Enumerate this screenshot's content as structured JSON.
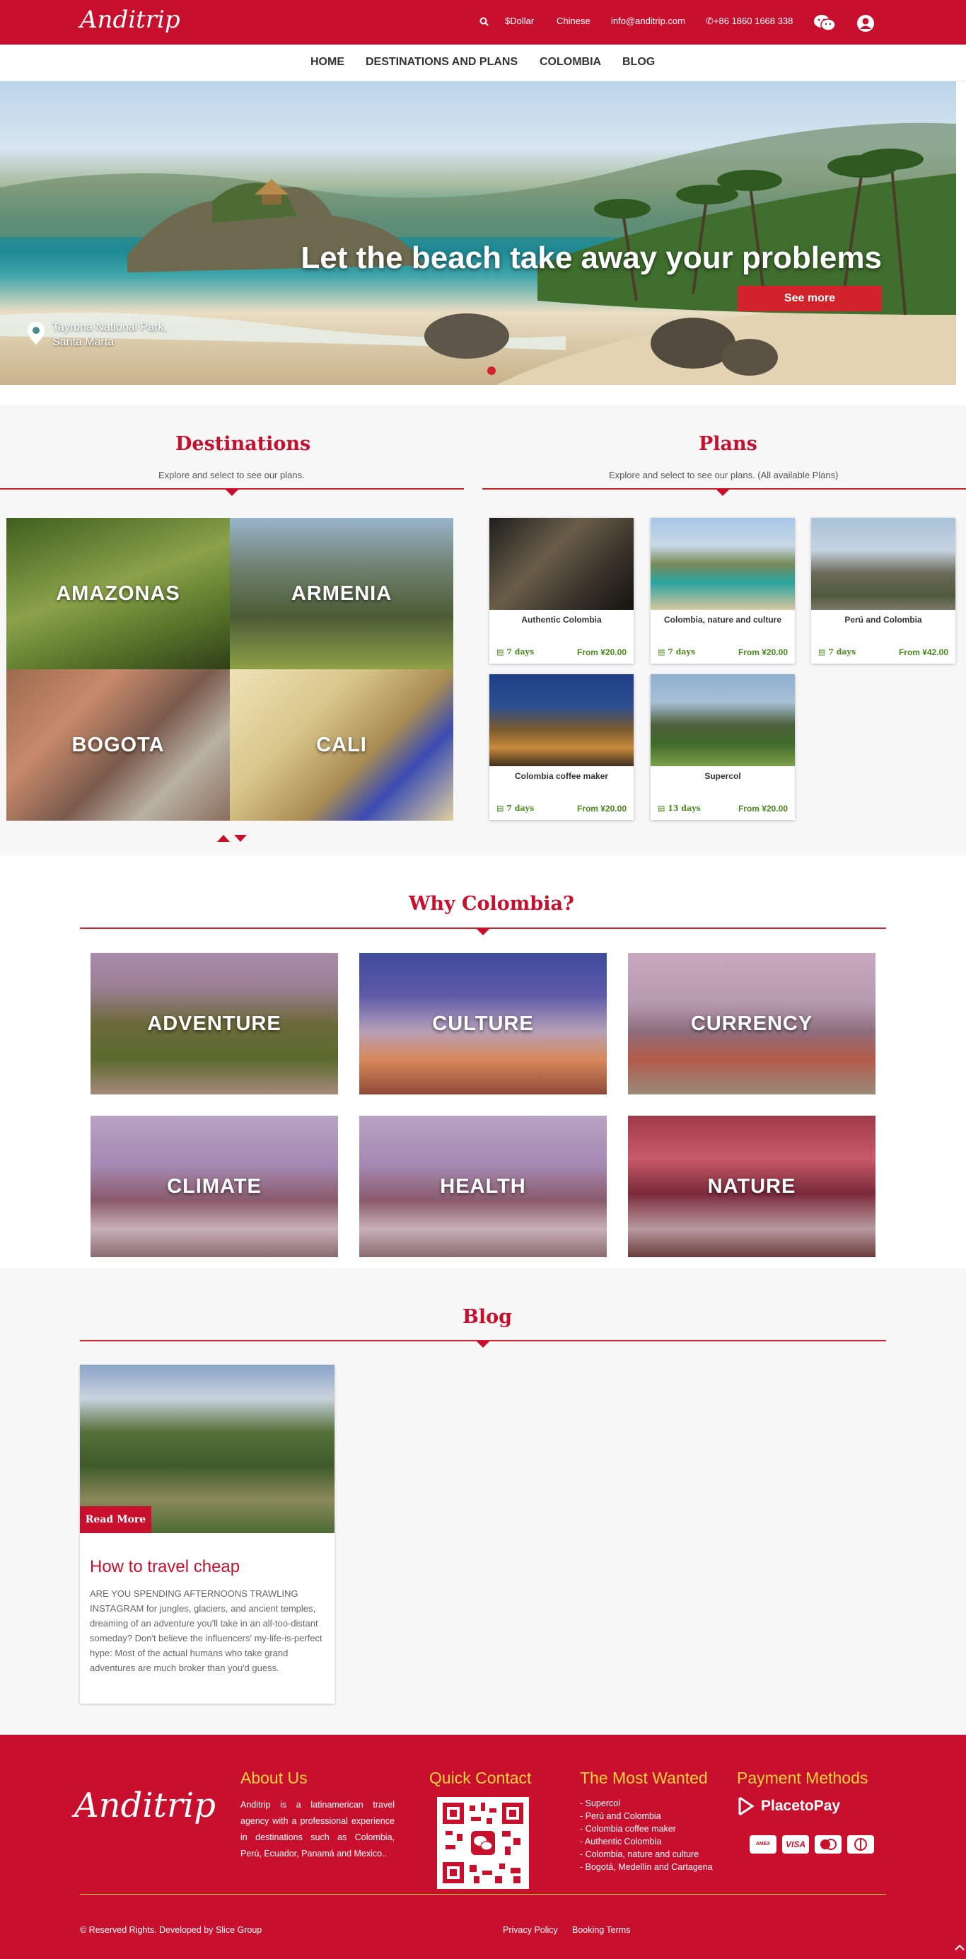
{
  "topbar": {
    "logo": "Anditrip",
    "currency": "$Dollar",
    "language": "Chinese",
    "email": "info@anditrip.com",
    "phone": "+86 1860 1668 338"
  },
  "nav": {
    "items": [
      "HOME",
      "DESTINATIONS AND PLANS",
      "COLOMBIA",
      "BLOG"
    ]
  },
  "hero": {
    "title": "Let the beach take away your problems",
    "button": "See more",
    "location_line1": "Tayrona National Park,",
    "location_line2": "Santa Marta"
  },
  "destinations": {
    "title": "Destinations",
    "subtitle": "Explore and select to see our plans.",
    "items": [
      "AMAZONAS",
      "ARMENIA",
      "BOGOTA",
      "CALI"
    ]
  },
  "plans": {
    "title": "Plans",
    "subtitle": "Explore and select to see our plans. (All available Plans)",
    "items": [
      {
        "name": "Authentic Colombia",
        "days": "7 days",
        "price": "From ¥20.00"
      },
      {
        "name": "Colombia, nature and culture",
        "days": "7 days",
        "price": "From ¥20.00"
      },
      {
        "name": "Perú and Colombia",
        "days": "7 days",
        "price": "From ¥42.00"
      },
      {
        "name": "Colombia coffee maker",
        "days": "7 days",
        "price": "From ¥20.00"
      },
      {
        "name": "Supercol",
        "days": "13 days",
        "price": "From ¥20.00"
      }
    ]
  },
  "why": {
    "title": "Why Colombia?",
    "items": [
      "ADVENTURE",
      "CULTURE",
      "CURRENCY",
      "CLIMATE",
      "HEALTH",
      "NATURE"
    ]
  },
  "blog": {
    "title": "Blog",
    "read_more": "Read More",
    "post_title": "How to travel cheap",
    "post_excerpt": "ARE YOU SPENDING AFTERNOONS TRAWLING INSTAGRAM for jungles, glaciers, and ancient temples, dreaming of an adventure you'll take in an all-too-distant someday? Don't believe the influencers' my-life-is-perfect hype: Most of the actual humans who take grand adventures are much broker than you'd guess."
  },
  "footer": {
    "logo": "Anditrip",
    "about_title": "About Us",
    "about_text": "Anditrip is a latinamerican travel agency with a professional experience in destinations such as Colombia, Perú, Ecuador, Panamá and Mexico..",
    "contact_title": "Quick Contact",
    "wanted_title": "The Most Wanted",
    "wanted_items": [
      "- Supercol",
      "- Perú and Colombia",
      "- Colombia coffee maker",
      "- Authentic Colombia",
      "- Colombia, nature and culture",
      "- Bogotá, Medellín and Cartagena"
    ],
    "payment_title": "Payment Methods",
    "payment_brand": "PlacetoPay",
    "copyright": "© Reserved Rights. Developed by Slice Group",
    "privacy": "Privacy Policy",
    "booking": "Booking Terms"
  },
  "colors": {
    "brand_red": "#c8102e",
    "footer_heading": "#ffd43b",
    "price_green": "#4a8a1c"
  },
  "icons": [
    "search-icon",
    "wechat-icon",
    "user-icon",
    "map-pin-icon",
    "calendar-icon",
    "arrow-up-icon",
    "arrow-down-icon",
    "scroll-top-icon"
  ]
}
